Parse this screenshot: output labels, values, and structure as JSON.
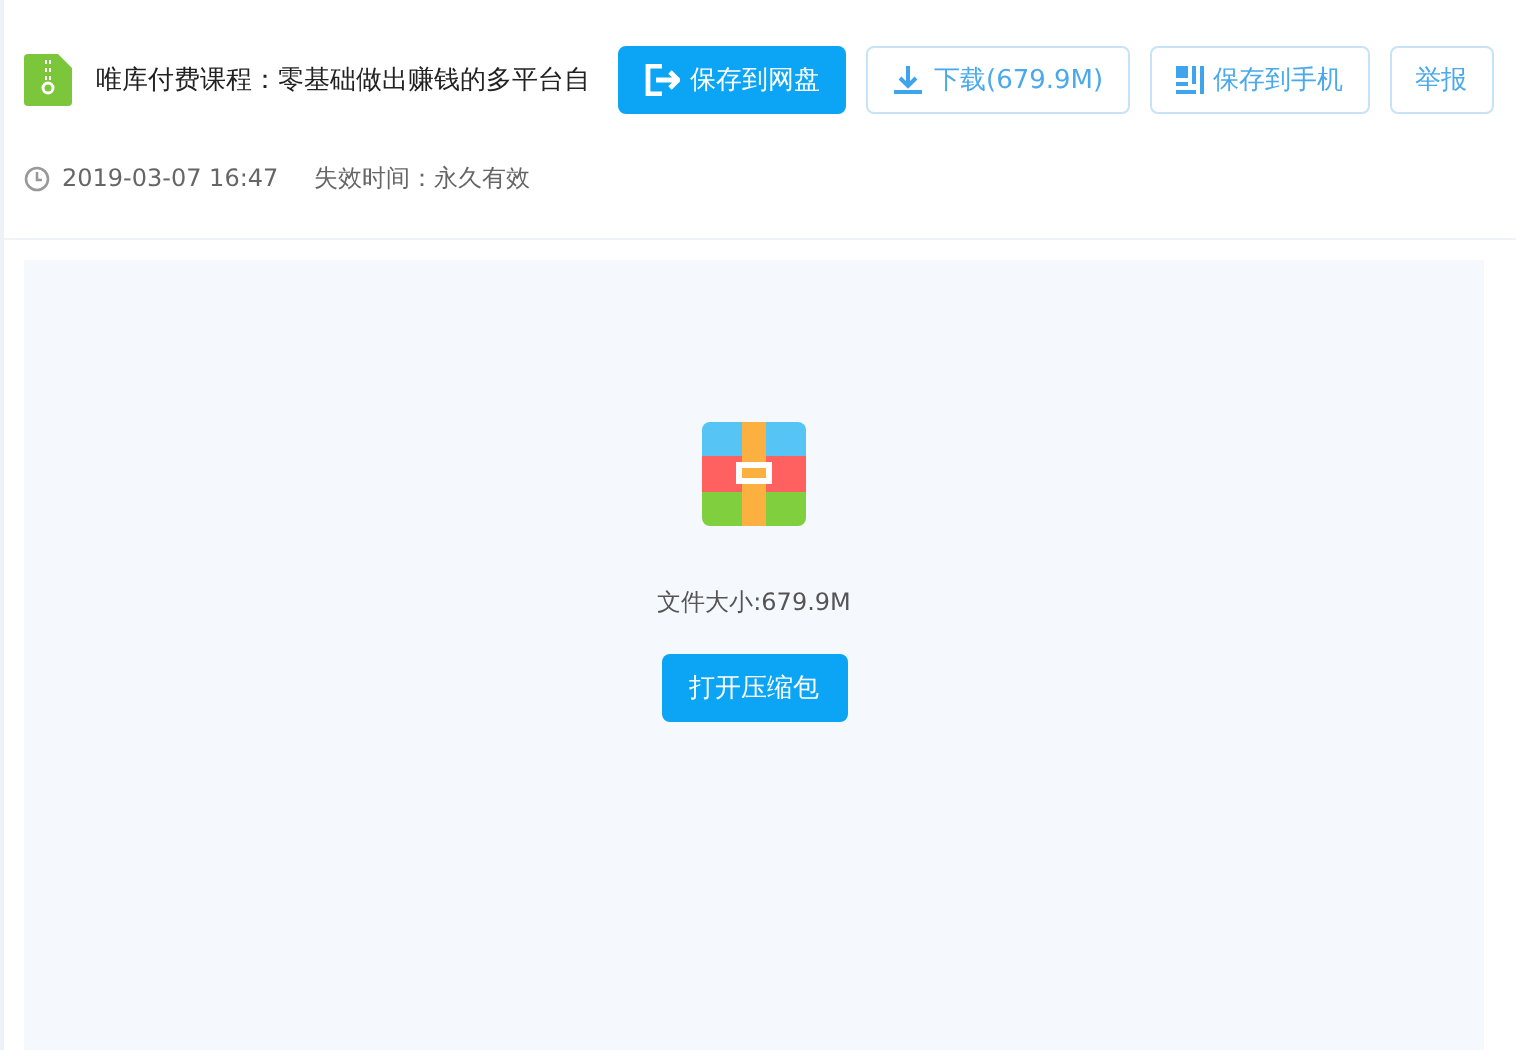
{
  "file": {
    "title": "唯库付费课程：零基础做出赚钱的多平台自",
    "date": "2019-03-07 16:47",
    "expiry": "失效时间：永久有效"
  },
  "actions": [
    {
      "label": "保存到网盘",
      "kind": "primary"
    },
    {
      "label": "下载(679.9M)",
      "kind": "download"
    },
    {
      "label": "保存到手机",
      "kind": "phone"
    },
    {
      "label": "举报",
      "kind": "plain"
    }
  ],
  "preview": {
    "size": "文件大小:679.9M",
    "button": "打开压缩包"
  }
}
